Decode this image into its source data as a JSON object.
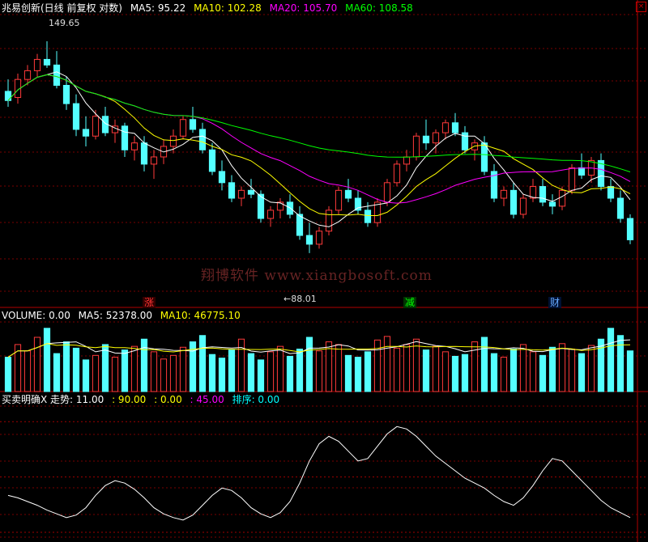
{
  "title": "兆易创新(日线 前复权 对数)",
  "main_panel": {
    "ma_legend": [
      {
        "label": "MA5: 95.22",
        "color": "#ffffff"
      },
      {
        "label": "MA10: 102.28",
        "color": "#ffff00"
      },
      {
        "label": "MA20: 105.70",
        "color": "#ff00ff"
      },
      {
        "label": "MA60: 108.58",
        "color": "#00ff00"
      }
    ],
    "peak_label": "149.65",
    "low_label": "←88.01",
    "watermark": "翔博软件 www.xiangbosoft.com",
    "event_marks": [
      {
        "text": "涨",
        "color": "#ff3333",
        "bg": "#330000"
      },
      {
        "text": "减",
        "color": "#00ff00",
        "bg": "#003300"
      },
      {
        "text": "财",
        "color": "#66aaff",
        "bg": "#001133"
      }
    ]
  },
  "volume_panel": {
    "legend": [
      {
        "label": "VOLUME: 0.00",
        "color": "#ffffff"
      },
      {
        "label": "MA5: 52378.00",
        "color": "#ffffff"
      },
      {
        "label": "MA10: 46775.10",
        "color": "#ffff00"
      }
    ]
  },
  "indicator_panel": {
    "legend": [
      {
        "label": "买卖明确X 走势: 11.00",
        "color": "#ffffff"
      },
      {
        "label": ": 90.00",
        "color": "#ffff00"
      },
      {
        "label": ": 0.00",
        "color": "#ffff00"
      },
      {
        "label": ": 45.00",
        "color": "#ff00ff"
      },
      {
        "label": "排序: 0.00",
        "color": "#00ffff"
      }
    ],
    "levels": [
      90,
      45,
      0
    ]
  },
  "close_icon": "close-icon",
  "chart_data": {
    "type": "candlestick",
    "title": "兆易创新(日线 前复权 对数)",
    "scale": "log",
    "ylim": [
      80,
      160
    ],
    "peak": 149.65,
    "low": 88.01,
    "ohlc": [
      [
        132,
        136,
        127,
        129
      ],
      [
        130,
        138,
        128,
        136
      ],
      [
        136,
        141,
        134,
        139
      ],
      [
        139,
        145,
        137,
        143
      ],
      [
        143,
        149.65,
        140,
        141
      ],
      [
        141,
        146,
        133,
        134
      ],
      [
        134,
        137,
        126,
        128
      ],
      [
        128,
        131,
        118,
        120
      ],
      [
        120,
        124,
        115,
        118
      ],
      [
        118,
        126,
        117,
        124
      ],
      [
        124,
        127,
        118,
        119
      ],
      [
        119,
        123,
        116,
        121
      ],
      [
        121,
        122,
        112,
        114
      ],
      [
        114,
        118,
        111,
        116
      ],
      [
        116,
        118,
        108,
        110
      ],
      [
        110,
        114,
        106,
        112
      ],
      [
        112,
        117,
        110,
        115
      ],
      [
        115,
        120,
        113,
        118
      ],
      [
        118,
        124,
        117,
        123
      ],
      [
        123,
        127,
        119,
        120
      ],
      [
        120,
        122,
        113,
        114
      ],
      [
        114,
        116,
        107,
        108
      ],
      [
        108,
        111,
        103,
        105
      ],
      [
        105,
        107,
        100,
        101
      ],
      [
        101,
        104,
        99,
        103
      ],
      [
        103,
        106,
        101,
        102
      ],
      [
        102,
        103,
        95,
        96
      ],
      [
        96,
        99,
        94,
        98
      ],
      [
        98,
        101,
        96,
        100
      ],
      [
        100,
        102,
        96,
        97
      ],
      [
        97,
        99,
        91,
        92
      ],
      [
        92,
        95,
        88.01,
        90
      ],
      [
        90,
        94,
        89,
        93
      ],
      [
        93,
        99,
        92,
        98
      ],
      [
        98,
        104,
        97,
        103
      ],
      [
        103,
        106,
        100,
        101
      ],
      [
        101,
        103,
        97,
        98
      ],
      [
        98,
        100,
        94,
        95
      ],
      [
        95,
        101,
        94,
        100
      ],
      [
        100,
        106,
        99,
        105
      ],
      [
        105,
        111,
        104,
        110
      ],
      [
        110,
        114,
        108,
        112
      ],
      [
        112,
        119,
        111,
        118
      ],
      [
        118,
        123,
        114,
        116
      ],
      [
        116,
        120,
        113,
        119
      ],
      [
        119,
        123,
        117,
        122
      ],
      [
        122,
        125,
        118,
        119
      ],
      [
        119,
        121,
        113,
        114
      ],
      [
        114,
        117,
        111,
        116
      ],
      [
        116,
        118,
        107,
        108
      ],
      [
        108,
        110,
        100,
        101
      ],
      [
        101,
        104,
        99,
        103
      ],
      [
        103,
        105,
        96,
        97
      ],
      [
        97,
        102,
        96,
        101
      ],
      [
        101,
        106,
        100,
        104
      ],
      [
        104,
        106,
        99,
        100
      ],
      [
        100,
        102,
        97,
        99
      ],
      [
        99,
        104,
        98,
        103
      ],
      [
        103,
        110,
        102,
        109
      ],
      [
        109,
        113,
        106,
        107
      ],
      [
        107,
        112,
        105,
        111
      ],
      [
        111,
        113,
        103,
        104
      ],
      [
        104,
        106,
        100,
        101
      ],
      [
        101,
        103,
        95,
        96
      ],
      [
        96,
        97,
        90,
        91
      ]
    ],
    "volume": [
      38,
      52,
      45,
      60,
      70,
      42,
      55,
      48,
      35,
      40,
      52,
      38,
      46,
      50,
      58,
      44,
      36,
      40,
      49,
      55,
      62,
      41,
      37,
      46,
      58,
      42,
      35,
      44,
      50,
      39,
      47,
      60,
      45,
      55,
      52,
      40,
      38,
      44,
      57,
      61,
      48,
      52,
      58,
      46,
      50,
      44,
      39,
      41,
      55,
      60,
      42,
      38,
      47,
      52,
      44,
      40,
      49,
      53,
      47,
      42,
      51,
      58,
      70,
      62,
      45
    ],
    "indicator": {
      "name": "走势",
      "values": [
        30,
        28,
        25,
        22,
        18,
        15,
        12,
        14,
        20,
        30,
        38,
        42,
        40,
        35,
        28,
        20,
        15,
        12,
        10,
        14,
        22,
        30,
        36,
        34,
        28,
        20,
        15,
        12,
        16,
        25,
        40,
        58,
        72,
        78,
        74,
        66,
        58,
        60,
        70,
        80,
        86,
        84,
        78,
        70,
        62,
        56,
        50,
        44,
        40,
        36,
        30,
        25,
        22,
        28,
        38,
        50,
        60,
        58,
        50,
        42,
        34,
        26,
        20,
        16,
        12
      ],
      "levels": [
        90,
        45,
        0
      ]
    },
    "ma": [
      {
        "name": "MA5",
        "value": 95.22
      },
      {
        "name": "MA10",
        "value": 102.28
      },
      {
        "name": "MA20",
        "value": 105.7
      },
      {
        "name": "MA60",
        "value": 108.58
      }
    ]
  }
}
